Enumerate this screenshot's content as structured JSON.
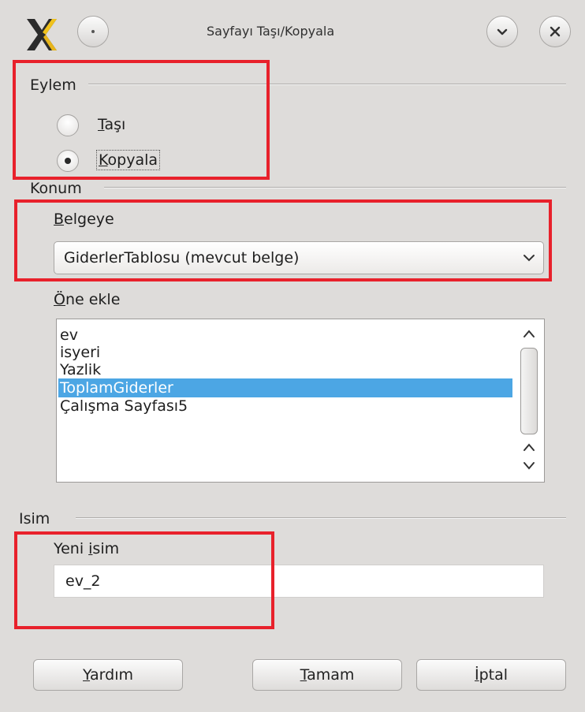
{
  "window": {
    "title": "Sayfayı Taşı/Kopyala"
  },
  "action_group": {
    "label": "Eylem",
    "options": [
      {
        "key": "T",
        "rest": "aşı",
        "checked": false
      },
      {
        "key": "K",
        "rest": "opyala",
        "checked": true
      }
    ]
  },
  "location_group": {
    "label": "Konum",
    "document_label_key": "B",
    "document_label_rest": "elgeye",
    "document_value": "GiderlerTablosu (mevcut belge)",
    "insert_before_key": "Ö",
    "insert_before_rest": "ne ekle",
    "sheets": [
      "ev",
      "isyeri",
      "Yazlik",
      "ToplamGiderler",
      "Çalışma Sayfası5"
    ],
    "selected_sheet": "ToplamGiderler"
  },
  "name_group": {
    "label": "Isim",
    "new_name_pre": "Yeni ",
    "new_name_key": "i",
    "new_name_rest": "sim",
    "value": "ev_2"
  },
  "buttons": {
    "help_key": "Y",
    "help_rest": "ardım",
    "ok_key": "T",
    "ok_rest": "amam",
    "cancel_key": "İ",
    "cancel_rest": "ptal"
  },
  "colors": {
    "selection": "#4ca6e4",
    "highlight_box": "#e8212b",
    "dialog_bg": "#dedcda"
  }
}
